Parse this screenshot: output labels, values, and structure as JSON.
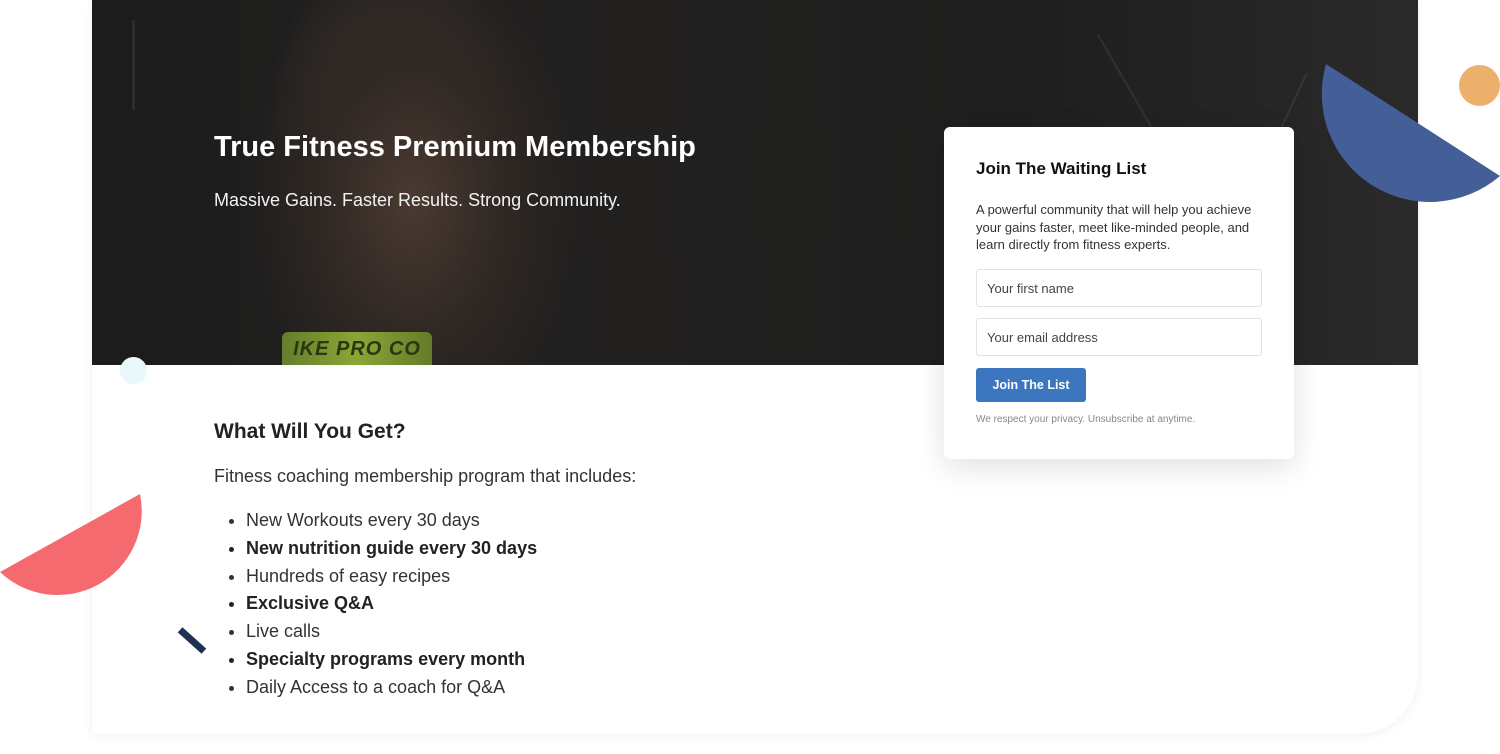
{
  "hero": {
    "title": "True Fitness Premium Membership",
    "subtitle": "Massive Gains. Faster Results. Strong Community.",
    "waistband_text": "IKE PRO CO"
  },
  "content": {
    "title": "What Will You Get?",
    "intro": "Fitness coaching membership program that includes:",
    "benefits": [
      {
        "text": "New Workouts every 30 days",
        "bold": false
      },
      {
        "text": "New nutrition guide every 30 days",
        "bold": true
      },
      {
        "text": "Hundreds of easy recipes",
        "bold": false
      },
      {
        "text": "Exclusive Q&A",
        "bold": true
      },
      {
        "text": "Live calls",
        "bold": false
      },
      {
        "text": "Specialty programs every month",
        "bold": true
      },
      {
        "text": "Daily Access to a coach for Q&A",
        "bold": false
      }
    ]
  },
  "signup": {
    "title": "Join The Waiting List",
    "description": "A powerful community that will help you achieve your gains faster, meet like-minded people, and learn directly from fitness experts.",
    "first_name_placeholder": "Your first name",
    "email_placeholder": "Your email address",
    "button_label": "Join The List",
    "privacy": "We respect your privacy. Unsubscribe at anytime."
  },
  "colors": {
    "accent": "#3b76bf",
    "deco_blue": "#445e98",
    "deco_orange": "#ebb06b",
    "deco_red": "#f46a6f",
    "deco_navy": "#1f3152"
  }
}
